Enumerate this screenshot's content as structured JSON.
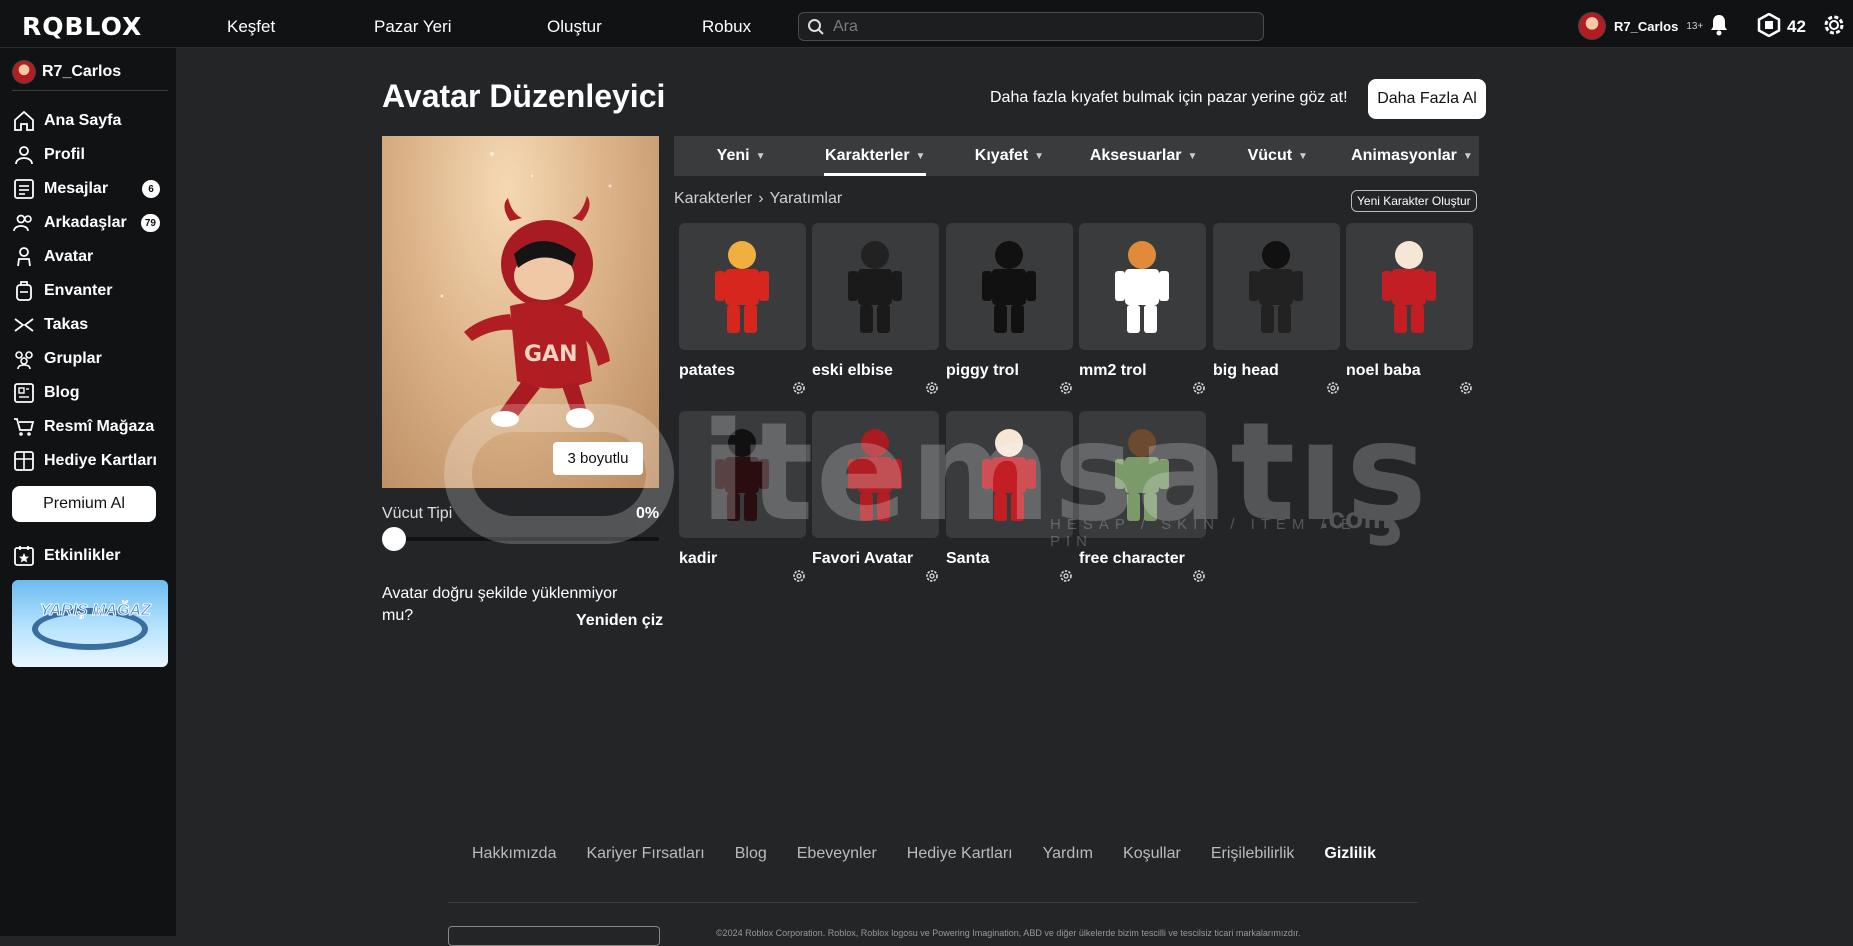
{
  "header": {
    "logo": "RQBLOX",
    "nav": [
      "Keşfet",
      "Pazar Yeri",
      "Oluştur",
      "Robux"
    ],
    "search_placeholder": "Ara",
    "username": "R7_Carlos",
    "age": "13+",
    "robux": "42"
  },
  "sidebar": {
    "username": "R7_Carlos",
    "items": [
      {
        "label": "Ana Sayfa",
        "icon": "home-icon"
      },
      {
        "label": "Profil",
        "icon": "profile-icon"
      },
      {
        "label": "Mesajlar",
        "icon": "messages-icon",
        "badge": "6"
      },
      {
        "label": "Arkadaşlar",
        "icon": "friends-icon",
        "badge": "79"
      },
      {
        "label": "Avatar",
        "icon": "avatar-icon"
      },
      {
        "label": "Envanter",
        "icon": "inventory-icon"
      },
      {
        "label": "Takas",
        "icon": "trade-icon"
      },
      {
        "label": "Gruplar",
        "icon": "groups-icon"
      },
      {
        "label": "Blog",
        "icon": "blog-icon"
      },
      {
        "label": "Resmî Mağaza",
        "icon": "store-icon"
      },
      {
        "label": "Hediye Kartları",
        "icon": "gift-card-icon"
      }
    ],
    "premium_button": "Premium Al",
    "events_label": "Etkinlikler",
    "events_banner_text": "YARIŞ MAĞAZ"
  },
  "main": {
    "title": "Avatar Düzenleyici",
    "promo_text": "Daha fazla kıyafet bulmak için pazar yerine göz at!",
    "promo_button": "Daha Fazla Al",
    "view_3d_button": "3 boyutlu",
    "body_type_label": "Vücut Tipi",
    "body_type_value": "0%",
    "body_type_fraction": 0,
    "warning_text": "Avatar doğru şekilde yüklenmiyor mu?",
    "redraw_button": "Yeniden çiz",
    "tabs": [
      {
        "label": "Yeni"
      },
      {
        "label": "Karakterler",
        "active": true
      },
      {
        "label": "Kıyafet"
      },
      {
        "label": "Aksesuarlar"
      },
      {
        "label": "Vücut"
      },
      {
        "label": "Animasyonlar"
      }
    ],
    "breadcrumb": [
      "Karakterler",
      "Yaratımlar"
    ],
    "new_character_button": "Yeni Karakter Oluştur",
    "characters": [
      {
        "name": "patates"
      },
      {
        "name": "eski elbise"
      },
      {
        "name": "piggy trol"
      },
      {
        "name": "mm2 trol"
      },
      {
        "name": "big head"
      },
      {
        "name": "noel baba"
      },
      {
        "name": "kadir"
      },
      {
        "name": "Favori Avatar"
      },
      {
        "name": "Santa"
      },
      {
        "name": "free character"
      }
    ]
  },
  "footer": {
    "links": [
      "Hakkımızda",
      "Kariyer Fırsatları",
      "Blog",
      "Ebeveynler",
      "Hediye Kartları",
      "Yardım",
      "Koşullar",
      "Erişilebilirlik",
      "Gizlilik"
    ],
    "copyright": "©2024 Roblox Corporation. Roblox, Roblox logosu ve Powering Imagination, ABD ve diğer ülkelerde bizim tescilli ve tescilsiz ticari markalarımızdır."
  },
  "watermark": {
    "brand": "itemsatış",
    "tagline": "HESAP / SKIN / ITEM / E-PIN",
    "suffix": ".com"
  }
}
